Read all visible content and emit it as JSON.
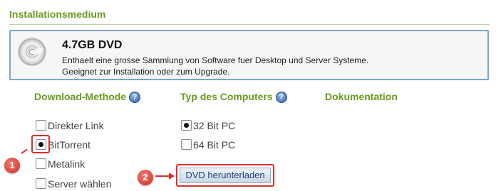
{
  "section_title": "Installationsmedium",
  "medium": {
    "title": "4.7GB DVD",
    "description_line1": "Enthaelt eine grosse Sammlung von Software fuer Desktop und Server Systeme.",
    "description_line2": "Geeignet zur Installation oder zum Upgrade.",
    "icon": "dvd-disc-icon"
  },
  "download_method": {
    "heading": "Download-Methode",
    "options": [
      {
        "label": "Direkter Link",
        "checked": false
      },
      {
        "label": "BitTorrent",
        "checked": true
      },
      {
        "label": "Metalink",
        "checked": false
      },
      {
        "label": "Server wählen",
        "checked": false
      }
    ]
  },
  "computer_type": {
    "heading": "Typ des Computers",
    "options": [
      {
        "label": "32 Bit PC",
        "checked": true
      },
      {
        "label": "64 Bit PC",
        "checked": false
      }
    ]
  },
  "documentation": {
    "heading": "Dokumentation"
  },
  "help_icon_glyph": "?",
  "download_button": {
    "label": "DVD herunterladen"
  },
  "annotations": {
    "badge1": "1",
    "badge2": "2",
    "color": "#d9302c"
  },
  "colors": {
    "accent_green": "#6a9a1f",
    "box_border": "#7aa6c8"
  }
}
